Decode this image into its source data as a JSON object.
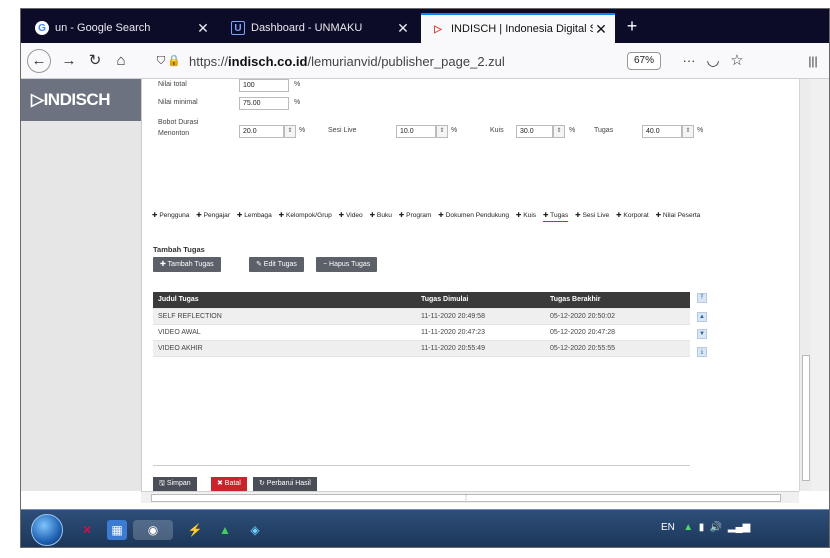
{
  "browser": {
    "tabs": [
      {
        "title": "un - Google Search",
        "favicon": "G"
      },
      {
        "title": "Dashboard - UNMAKU",
        "favicon": "U"
      },
      {
        "title": "INDISCH | Indonesia Digital Sch",
        "favicon": "▷"
      }
    ],
    "url_prefix": "https://",
    "url_host": "indisch.co.id",
    "url_path": "/lemurianvid/publisher_page_2.zul",
    "zoom": "67%"
  },
  "background_page": {
    "logo": "INDISCH"
  },
  "form": {
    "nilai_total_label": "Nilai total",
    "nilai_total_value": "100",
    "nilai_minimal_label": "Nilai minimal",
    "nilai_minimal_value": "75.00",
    "bobot_label": "Bobot Durasi Menonton",
    "bobot_value": "20.0",
    "sesi_live_label": "Sesi Live",
    "sesi_live_value": "10.0",
    "kuis_label": "Kuis",
    "kuis_value": "30.0",
    "tugas_label": "Tugas",
    "tugas_value": "40.0",
    "percent": "%"
  },
  "menu": [
    "✚ Pengguna",
    "✚ Pengajar",
    "✚ Lembaga",
    "✚ Kelompok/Grup",
    "✚ Video",
    "✚ Buku",
    "✚ Program",
    "✚ Dokumen Pendukung",
    "✚ Kuis",
    "✚ Tugas",
    "✚ Sesi Live",
    "✚ Korporat",
    "✚ Nilai Peserta"
  ],
  "section": {
    "title": "Tambah Tugas",
    "add_btn": "✚ Tambah Tugas",
    "edit_btn": "✎ Edit Tugas",
    "delete_btn": "− Hapus Tugas"
  },
  "table": {
    "headers": [
      "Judul Tugas",
      "Tugas Dimulai",
      "Tugas Berakhir"
    ],
    "rows": [
      [
        "SELF REFLECTION",
        "11-11-2020 20:49:58",
        "05-12-2020 20:50:02"
      ],
      [
        "VIDEO AWAL",
        "11-11-2020 20:47:23",
        "05-12-2020 20:47:28"
      ],
      [
        "VIDEO AKHIR",
        "11-11-2020 20:55:49",
        "05-12-2020 20:55:55"
      ]
    ]
  },
  "footer": {
    "save": "🖫 Simpan",
    "cancel": "✖ Batal",
    "refresh": "↻ Perbarui Hasil"
  },
  "taskbar": {
    "tray_lang": "EN"
  },
  "colors": {
    "tab_bar": "#0c0c28",
    "active_tab_accent": "#0a84ff",
    "button_gray": "#5b6069",
    "save_button": "#4a4f57",
    "cancel_button": "#c9242b",
    "table_header": "#3a3a3a"
  }
}
